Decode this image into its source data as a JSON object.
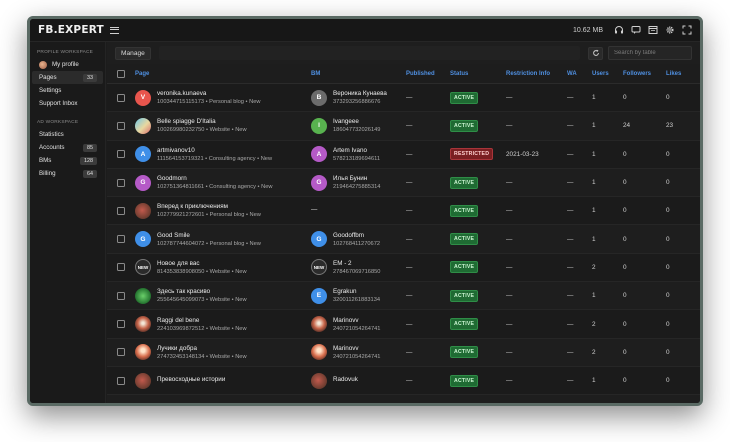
{
  "app": {
    "brand": "FB.EXPERT",
    "memory": "10.62 MB"
  },
  "icons": {
    "menu": "hamburger-icon",
    "headset": "headset-icon",
    "chat": "chat-icon",
    "window": "window-icon",
    "settings": "gear-icon",
    "expand": "expand-icon",
    "refresh": "refresh-icon"
  },
  "sidebar": {
    "profile_section": "PROFILE WORKSPACE",
    "ad_section": "AD WORKSPACE",
    "profile_items": [
      {
        "label": "My profile",
        "badge": ""
      },
      {
        "label": "Pages",
        "badge": "33"
      },
      {
        "label": "Settings",
        "badge": ""
      },
      {
        "label": "Support Inbox",
        "badge": ""
      }
    ],
    "ad_items": [
      {
        "label": "Statistics",
        "badge": ""
      },
      {
        "label": "Accounts",
        "badge": "85"
      },
      {
        "label": "BMs",
        "badge": "128"
      },
      {
        "label": "Billing",
        "badge": "64"
      }
    ]
  },
  "toolbar": {
    "manage": "Manage",
    "search_placeholder": "Search by table"
  },
  "columns": {
    "page": "Page",
    "bm": "BM",
    "published": "Published",
    "status": "Status",
    "restriction": "Restriction Info",
    "wa": "WA",
    "users": "Users",
    "followers": "Followers",
    "likes": "Likes"
  },
  "colors": {
    "accent": "#4f8fe0",
    "active": "#1f6b33",
    "restricted": "#7a1f22"
  },
  "rows": [
    {
      "page_avatar": "V",
      "page_color": "#e8554d",
      "page_name": "veronika.kunaeva",
      "page_sub": "100344715115173 • Personal blog • New",
      "bm_avatar": "B",
      "bm_color": "#6b6b6b",
      "bm_name": "Вероника Кунаева",
      "bm_id": "373293256886676",
      "published": "—",
      "status": "ACTIVE",
      "restriction": "—",
      "wa": "—",
      "users": "1",
      "followers": "0",
      "likes": "0"
    },
    {
      "page_avatar": "",
      "page_color": "img-beach",
      "page_name": "Belle spiagge D'Italia",
      "page_sub": "100269980232750 • Website • New",
      "bm_avatar": "I",
      "bm_color": "#58b24f",
      "bm_name": "Ivangeee",
      "bm_id": "186047732026149",
      "published": "—",
      "status": "ACTIVE",
      "restriction": "—",
      "wa": "—",
      "users": "1",
      "followers": "24",
      "likes": "23"
    },
    {
      "page_avatar": "A",
      "page_color": "#3f8fe8",
      "page_name": "artmivanov10",
      "page_sub": "111564153719321 • Consulting agency • New",
      "bm_avatar": "A",
      "bm_color": "#b55ac7",
      "bm_name": "Artem Ivano",
      "bm_id": "578213189694611",
      "published": "—",
      "status": "RESTRICTED",
      "restriction": "2021-03-23",
      "wa": "—",
      "users": "1",
      "followers": "0",
      "likes": "0"
    },
    {
      "page_avatar": "G",
      "page_color": "#b55ac7",
      "page_name": "Goodmorn",
      "page_sub": "102751364811661 • Consulting agency • New",
      "bm_avatar": "G",
      "bm_color": "#b55ac7",
      "bm_name": "Илья Бунин",
      "bm_id": "219464275885314",
      "published": "—",
      "status": "ACTIVE",
      "restriction": "—",
      "wa": "—",
      "users": "1",
      "followers": "0",
      "likes": "0"
    },
    {
      "page_avatar": "",
      "page_color": "img-journey",
      "page_name": "Вперед к приключениям",
      "page_sub": "102779921272601 • Personal blog • New",
      "bm_avatar": "",
      "bm_color": "",
      "bm_name": "—",
      "bm_id": "",
      "published": "—",
      "status": "ACTIVE",
      "restriction": "—",
      "wa": "—",
      "users": "1",
      "followers": "0",
      "likes": "0"
    },
    {
      "page_avatar": "G",
      "page_color": "#3f8fe8",
      "page_name": "Good Smile",
      "page_sub": "102787744604072 • Personal blog • New",
      "bm_avatar": "G",
      "bm_color": "#3f8fe8",
      "bm_name": "Goodoffbm",
      "bm_id": "102768411270672",
      "published": "—",
      "status": "ACTIVE",
      "restriction": "—",
      "wa": "—",
      "users": "1",
      "followers": "0",
      "likes": "0"
    },
    {
      "page_avatar": "NEW",
      "page_color": "img-news",
      "page_name": "Новое для вас",
      "page_sub": "814353838908050 • Website • New",
      "bm_avatar": "NEW",
      "bm_color": "img-news",
      "bm_name": "EM - 2",
      "bm_id": "278467069716850",
      "published": "—",
      "status": "ACTIVE",
      "restriction": "—",
      "wa": "—",
      "users": "2",
      "followers": "0",
      "likes": "0"
    },
    {
      "page_avatar": "",
      "page_color": "img-green",
      "page_name": "Здесь так красиво",
      "page_sub": "255645645099073 • Website • New",
      "bm_avatar": "E",
      "bm_color": "#3f8fe8",
      "bm_name": "Egrakun",
      "bm_id": "320011261883134",
      "published": "—",
      "status": "ACTIVE",
      "restriction": "—",
      "wa": "—",
      "users": "1",
      "followers": "0",
      "likes": "0"
    },
    {
      "page_avatar": "",
      "page_color": "img-blast",
      "page_name": "Raggi del bene",
      "page_sub": "224103969872512 • Website • New",
      "bm_avatar": "",
      "bm_color": "img-blast",
      "bm_name": "Marinovv",
      "bm_id": "240721054264741",
      "published": "—",
      "status": "ACTIVE",
      "restriction": "—",
      "wa": "—",
      "users": "2",
      "followers": "0",
      "likes": "0"
    },
    {
      "page_avatar": "",
      "page_color": "img-cloud",
      "page_name": "Лучики добра",
      "page_sub": "274732453148134 • Website • New",
      "bm_avatar": "",
      "bm_color": "img-cloud",
      "bm_name": "Marinovv",
      "bm_id": "240721054264741",
      "published": "—",
      "status": "ACTIVE",
      "restriction": "—",
      "wa": "—",
      "users": "2",
      "followers": "0",
      "likes": "0"
    },
    {
      "page_avatar": "",
      "page_color": "img-journey",
      "page_name": "Превосходные истории",
      "page_sub": "",
      "bm_avatar": "",
      "bm_color": "img-journey",
      "bm_name": "Radovuk",
      "bm_id": "",
      "published": "—",
      "status": "ACTIVE",
      "restriction": "—",
      "wa": "—",
      "users": "1",
      "followers": "0",
      "likes": "0"
    }
  ]
}
